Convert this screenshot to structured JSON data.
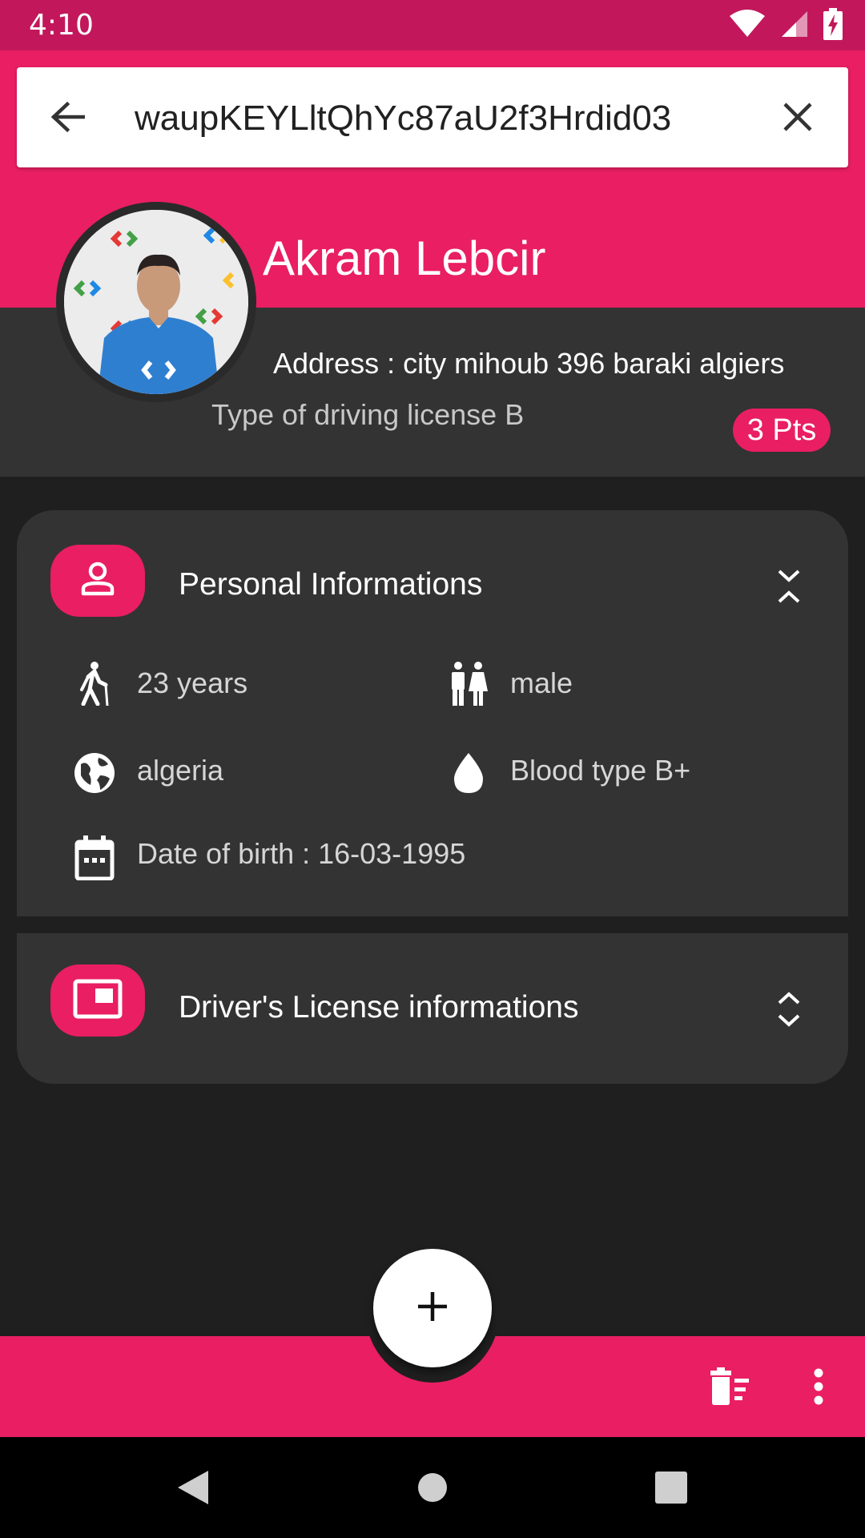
{
  "status_bar": {
    "time": "4:10",
    "icons": [
      "wifi-icon",
      "cell-signal-icon",
      "battery-charging-icon"
    ]
  },
  "search": {
    "value": "waupKEYLltQhYc87aU2f3Hrdid03",
    "back_icon": "arrow-back-icon",
    "clear_icon": "close-icon"
  },
  "profile": {
    "name": "Akram Lebcir",
    "address": "Address : city mihoub 396 baraki algiers",
    "license_type": "Type of driving license B",
    "points": "3 Pts"
  },
  "personal_section": {
    "title": "Personal Informations",
    "icon": "person-icon",
    "expand_icon": "collapse-icon",
    "items": {
      "age": "23 years",
      "gender": "male",
      "country": "algeria",
      "blood_type": "Blood type B+",
      "birth_date": "Date of birth : 16-03-1995"
    }
  },
  "license_section": {
    "title": "Driver's License informations",
    "icon": "license-card-icon",
    "expand_icon": "expand-icon"
  },
  "bottom_bar": {
    "fab_icon": "add-icon",
    "actions": [
      "delete-sweep-icon",
      "more-vert-icon"
    ]
  },
  "colors": {
    "primary": "#e91e63",
    "primary_dark": "#c2185b",
    "surface": "#333333",
    "background": "#1f1f1f"
  }
}
